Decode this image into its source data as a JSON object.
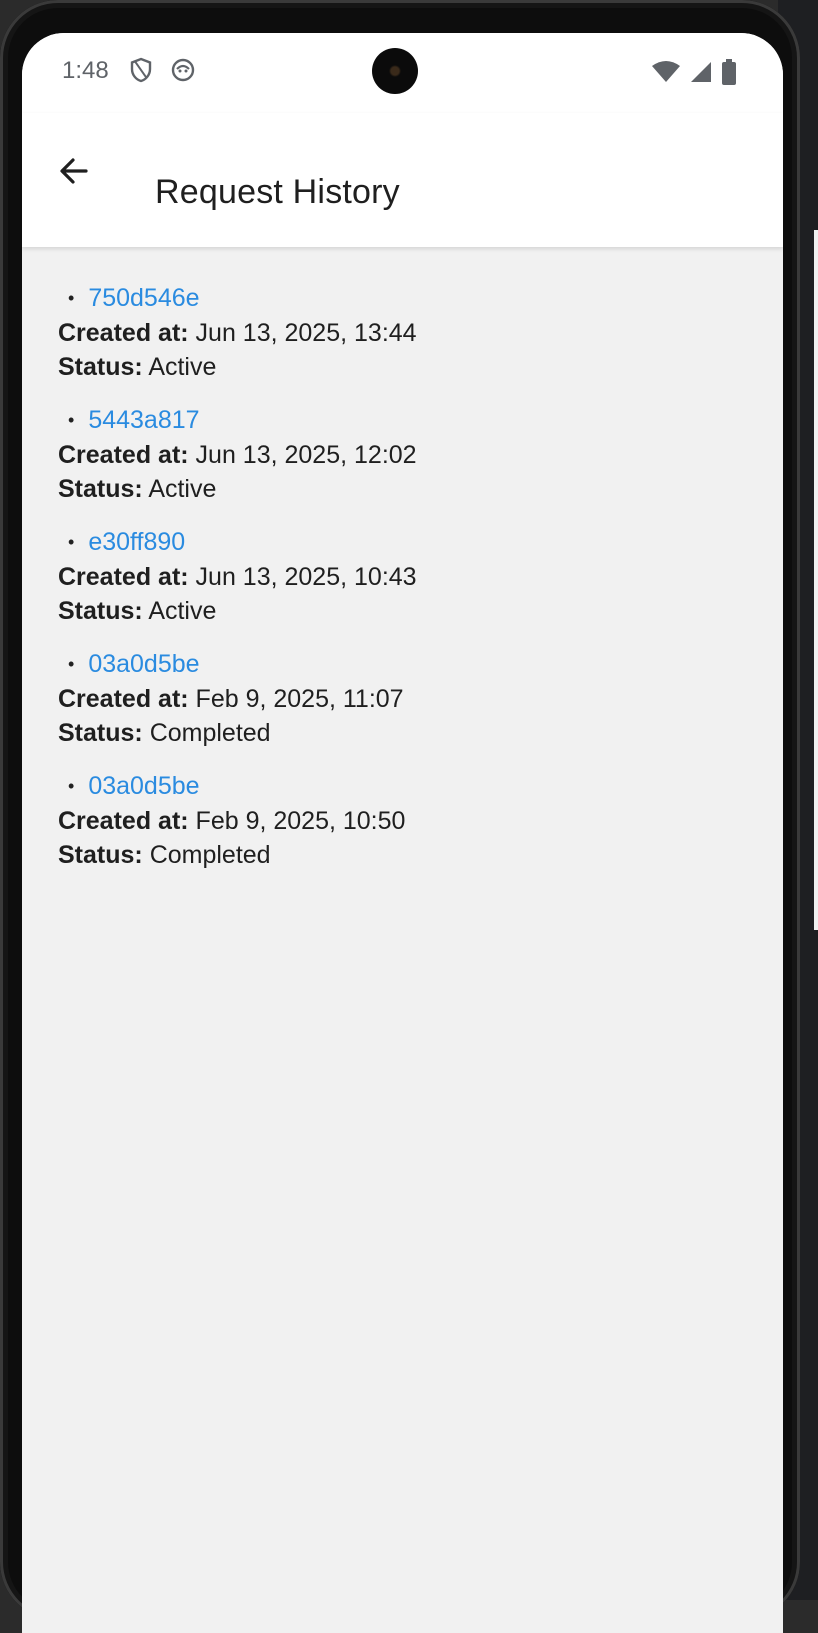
{
  "status_bar": {
    "time": "1:48",
    "icons": [
      "shield-icon",
      "app-notification-icon"
    ],
    "system_icons": [
      "wifi-icon",
      "signal-icon",
      "battery-icon"
    ]
  },
  "app_bar": {
    "back_icon": "arrow-back-icon",
    "title": "Request History"
  },
  "labels": {
    "created_at": "Created at:",
    "status": "Status:"
  },
  "requests": [
    {
      "id": "750d546e",
      "created_at": "Jun 13, 2025, 13:44",
      "status": "Active"
    },
    {
      "id": "5443a817",
      "created_at": "Jun 13, 2025, 12:02",
      "status": "Active"
    },
    {
      "id": "e30ff890",
      "created_at": "Jun 13, 2025, 10:43",
      "status": "Active"
    },
    {
      "id": "03a0d5be",
      "created_at": "Feb 9, 2025, 11:07",
      "status": "Completed"
    },
    {
      "id": "03a0d5be",
      "created_at": "Feb 9, 2025, 10:50",
      "status": "Completed"
    }
  ],
  "colors": {
    "link": "#2a8be0",
    "background": "#f1f1f1",
    "app_bar": "#ffffff"
  }
}
